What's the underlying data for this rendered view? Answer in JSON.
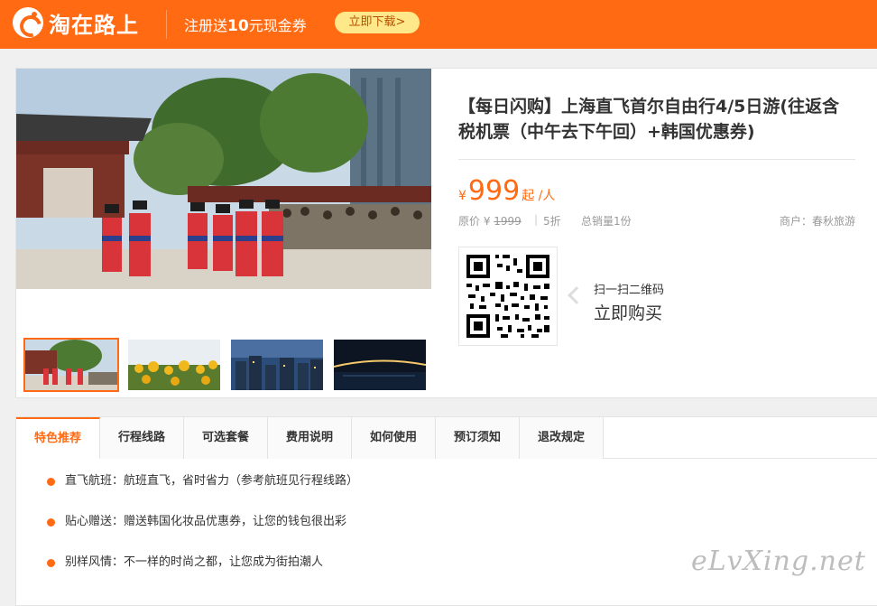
{
  "header": {
    "logo_text": "淘在路上",
    "promo_prefix": "注册送",
    "promo_amount": "10",
    "promo_suffix": "元现金券",
    "download_label": "立即下载>",
    "brand_color": "#ff6a13"
  },
  "product": {
    "title": "【每日闪购】上海直飞首尔自由行4/5日游(往返含税机票（中午去下午回）+韩国优惠券)",
    "currency": "¥",
    "price": "999",
    "price_unit": "起 /人",
    "original_label": "原价 ¥",
    "original_price": "1999",
    "discount": "5折",
    "sales": "总销量1份",
    "merchant": "商户：春秋旅游",
    "qr_hint": "扫一扫二维码",
    "qr_action": "立即购买"
  },
  "tabs": [
    {
      "label": "特色推荐",
      "active": true
    },
    {
      "label": "行程线路"
    },
    {
      "label": "可选套餐"
    },
    {
      "label": "费用说明"
    },
    {
      "label": "如何使用"
    },
    {
      "label": "预订须知"
    },
    {
      "label": "退改规定"
    }
  ],
  "features": [
    "直飞航班：航班直飞，省时省力（参考航班见行程线路）",
    "贴心赠送：赠送韩国化妆品优惠券，让您的钱包很出彩",
    "别样风情：不一样的时尚之都，让您成为街拍潮人"
  ],
  "watermark": "eLvXing.net"
}
